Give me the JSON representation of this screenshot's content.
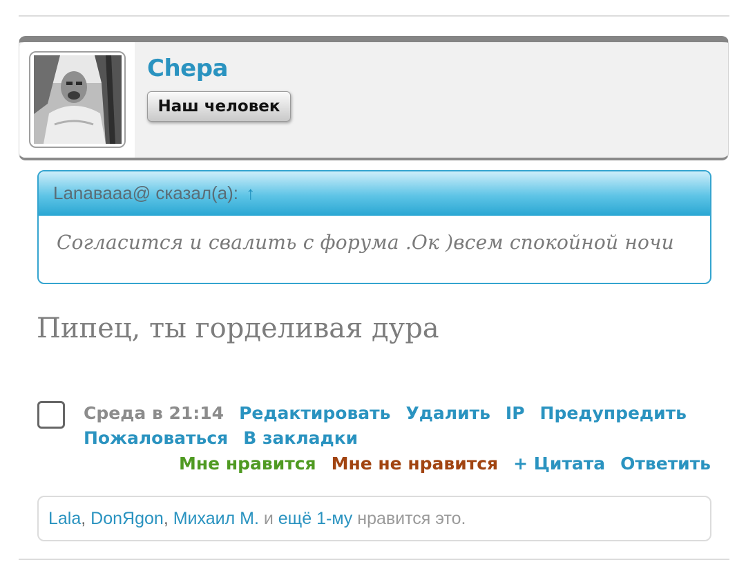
{
  "user": {
    "name": "Chepa",
    "rank": "Наш человек"
  },
  "quote": {
    "author_line": "Lanaвааа@ сказал(а):",
    "arrow": "↑",
    "text": "Согласится и свалить с форума .Ок )всем спокойной ночи"
  },
  "post": {
    "text": "Пипец, ты горделивая дура"
  },
  "meta": {
    "date": "Среда в 21:14",
    "edit": "Редактировать",
    "delete": "Удалить",
    "ip": "IP",
    "warn": "Предупредить",
    "report": "Пожаловаться",
    "bookmark": "В закладки",
    "like": "Мне нравится",
    "dislike": "Мне не нравится",
    "quote": "+ Цитата",
    "reply": "Ответить"
  },
  "likes": {
    "users": [
      "Lala",
      "DonЯgon",
      "Михаил М."
    ],
    "separator": ",",
    "and": "и",
    "more": "ещё 1-му",
    "suffix": "нравится это."
  },
  "colors": {
    "link": "#2a93c0",
    "like": "#4f9a22",
    "dislike": "#a14411",
    "quote_border": "#34a4cf"
  }
}
